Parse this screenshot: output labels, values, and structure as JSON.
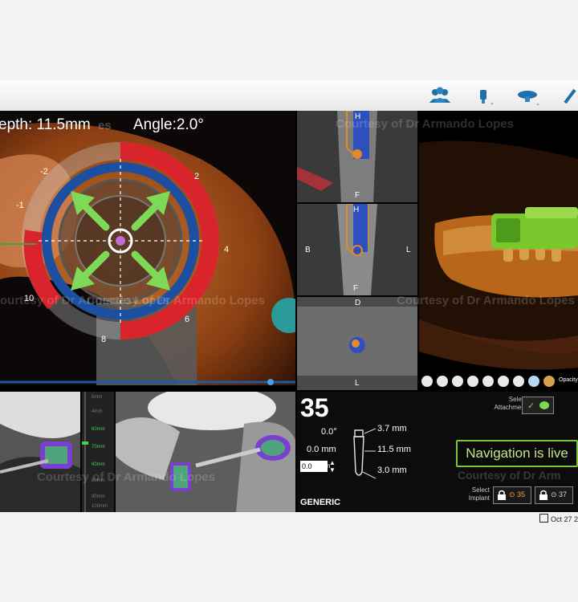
{
  "overlay": {
    "depth": "epth: 11.5mm",
    "angle": "Angle:2.0°",
    "ticks": [
      "-2",
      "2",
      "-1",
      "4",
      "10",
      "6",
      "8"
    ]
  },
  "watermarks": {
    "top": "Courtesy of Dr Armando Lopes",
    "mid": "Courtesy of Dr Armando Lopes",
    "mid_right": "Courtesy of Dr Armando Lopes",
    "bottom": "Courtesy of Dr Armando Lopes",
    "bottom_right": "Courtesy of Dr Arm",
    "left_part": "ourtesy of Dr Armando Lopes",
    "hidden_part": "es"
  },
  "slices": {
    "s1": {
      "top": "H",
      "bottom": "F"
    },
    "s2": {
      "top": "H",
      "left": "B",
      "right": "L",
      "bottom": "F"
    },
    "s3": {
      "top": "D",
      "bottom": "L"
    }
  },
  "view3d": {
    "opacity_label": "Opacity"
  },
  "depth_scale": [
    "5mm",
    "4mm",
    "60mm",
    "70mm",
    "60mm",
    "80mm",
    "90mm",
    "100mm",
    "70mm"
  ],
  "implant_panel": {
    "tooth_number": "35",
    "angle": "0.0°",
    "offset": "0.0 mm",
    "length_top": "3.7 mm",
    "length_mid": "11.5 mm",
    "length_bottom": "3.0 mm",
    "input_value": "0.0",
    "input_unit": "mm",
    "brand": "GENERIC"
  },
  "right_panel": {
    "select_attachment": "Select Attachment",
    "navigation_status": "Navigation is live",
    "select_implant": "Select Implant",
    "implant_a": "35",
    "implant_b": "37"
  },
  "status": {
    "date": "Oct 27 2"
  }
}
